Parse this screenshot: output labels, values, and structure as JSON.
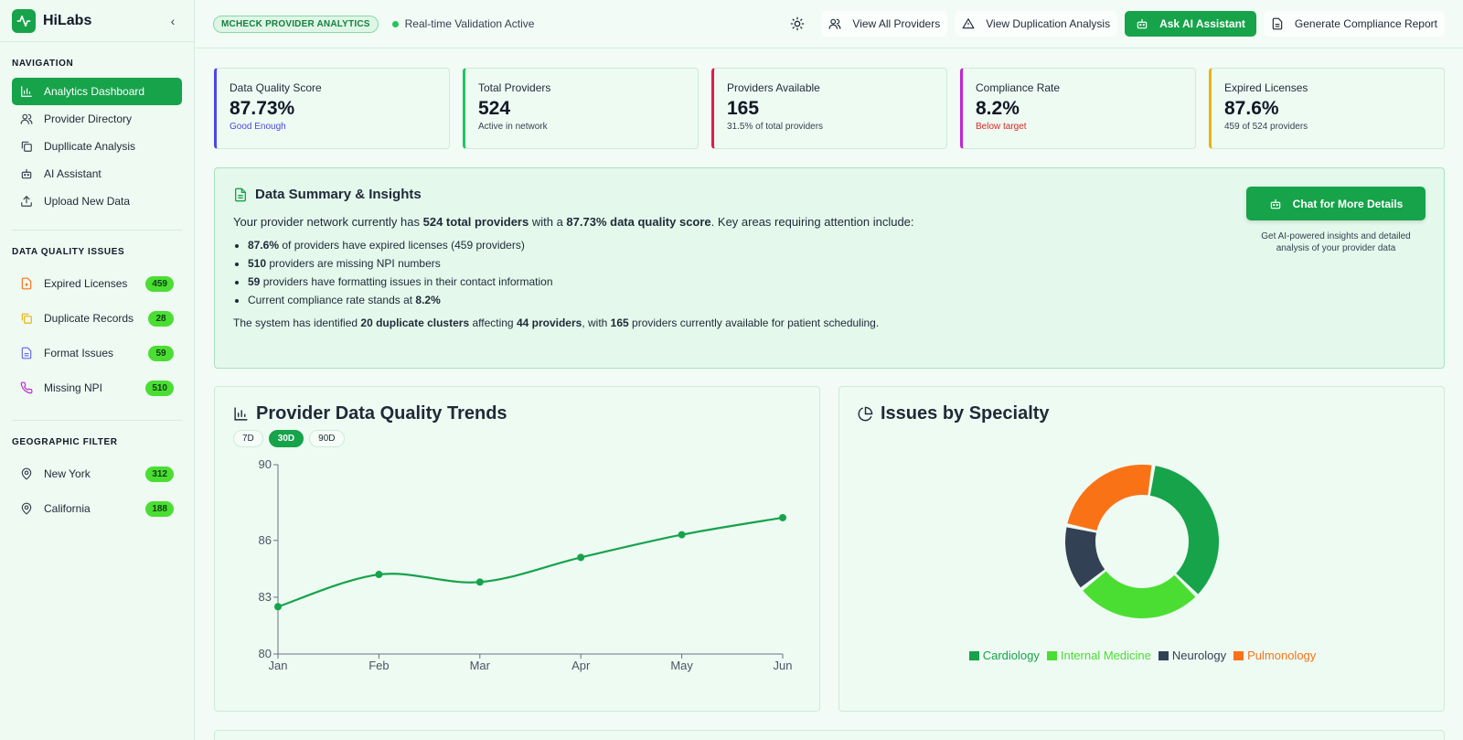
{
  "brand": {
    "name": "HiLabs"
  },
  "sidebar": {
    "nav_title": "NAVIGATION",
    "nav_items": [
      {
        "label": "Analytics Dashboard",
        "icon": "bar-chart-icon"
      },
      {
        "label": "Provider Directory",
        "icon": "users-icon"
      },
      {
        "label": "Dupllicate Analysis",
        "icon": "copy-icon"
      },
      {
        "label": "AI Assistant",
        "icon": "bot-icon"
      },
      {
        "label": "Upload New Data",
        "icon": "upload-icon"
      }
    ],
    "issues_title": "DATA QUALITY ISSUES",
    "issues": [
      {
        "label": "Expired Licenses",
        "count": "459",
        "icon": "file-x-icon",
        "color": "#f97316"
      },
      {
        "label": "Duplicate Records",
        "count": "28",
        "icon": "copy-icon",
        "color": "#eab308"
      },
      {
        "label": "Format Issues",
        "count": "59",
        "icon": "file-text-icon",
        "color": "#6366f1"
      },
      {
        "label": "Missing NPI",
        "count": "510",
        "icon": "phone-icon",
        "color": "#c026d3"
      }
    ],
    "geo_title": "GEOGRAPHIC FILTER",
    "geo": [
      {
        "label": "New York",
        "count": "312",
        "icon": "map-pin-icon"
      },
      {
        "label": "California",
        "count": "188",
        "icon": "map-pin-icon"
      }
    ]
  },
  "header": {
    "pill": "MCHECK PROVIDER ANALYTICS",
    "status": "Real-time Validation Active",
    "buttons": {
      "view_providers": "View All Providers",
      "view_duplication": "View Duplication Analysis",
      "ask_ai": "Ask AI Assistant",
      "compliance": "Generate Compliance Report"
    }
  },
  "stats": [
    {
      "label": "Data Quality Score",
      "value": "87.73%",
      "sub": "Good Enough",
      "accent": "#4f46e5",
      "sub_color": "#4f46e5"
    },
    {
      "label": "Total Providers",
      "value": "524",
      "sub": "Active in network",
      "accent": "#22c55e",
      "sub_color": "#374151"
    },
    {
      "label": "Providers Available",
      "value": "165",
      "sub": "31.5% of total providers",
      "accent": "#e11d48",
      "sub_color": "#374151"
    },
    {
      "label": "Compliance Rate",
      "value": "8.2%",
      "sub": "Below target",
      "accent": "#c026d3",
      "sub_color": "#dc2626"
    },
    {
      "label": "Expired Licenses",
      "value": "87.6%",
      "sub": "459 of 524 providers",
      "accent": "#eab308",
      "sub_color": "#374151"
    }
  ],
  "summary": {
    "title": "Data Summary & Insights",
    "intro": {
      "a": "Your provider network currently has ",
      "b": "524 total providers",
      "c": " with a ",
      "d": "87.73% data quality score",
      "e": ". Key areas requiring attention include:"
    },
    "bullets": [
      {
        "bold": "87.6%",
        "text": " of providers have expired licenses (459 providers)"
      },
      {
        "bold": "510",
        "text": " providers are missing NPI numbers"
      },
      {
        "bold": "59",
        "text": " providers have formatting issues in their contact information"
      },
      {
        "pre": "Current compliance rate stands at ",
        "bold": "8.2%"
      }
    ],
    "footer": {
      "a": "The system has identified ",
      "b": "20 duplicate clusters",
      "c": " affecting ",
      "d": "44 providers",
      "e": ", with ",
      "f": "165",
      "g": " providers currently available for patient scheduling."
    },
    "chat_button": "Chat for More Details",
    "chat_note": "Get AI-powered insights and detailed analysis of your provider data"
  },
  "trend_panel": {
    "title": "Provider Data Quality Trends",
    "ranges": [
      "7D",
      "30D",
      "90D"
    ],
    "active_range": "30D"
  },
  "specialty_panel": {
    "title": "Issues by Specialty"
  },
  "chart_data": [
    {
      "type": "line",
      "title": "Provider Data Quality Trends",
      "x": [
        "Jan",
        "Feb",
        "Mar",
        "Apr",
        "May",
        "Jun"
      ],
      "values": [
        82.5,
        84.2,
        83.8,
        85.1,
        86.3,
        87.2
      ],
      "ylim": [
        80,
        90
      ],
      "yticks": [
        80,
        83,
        86,
        90
      ],
      "color": "#16a34a",
      "grid": false
    },
    {
      "type": "pie",
      "donut": true,
      "title": "Issues by Specialty",
      "categories": [
        "Cardiology",
        "Internal Medicine",
        "Neurology",
        "Pulmonology"
      ],
      "values": [
        35,
        27,
        14,
        24
      ],
      "colors": [
        "#16a34a",
        "#4ade32",
        "#334155",
        "#f97316"
      ],
      "legend": "bottom"
    }
  ]
}
